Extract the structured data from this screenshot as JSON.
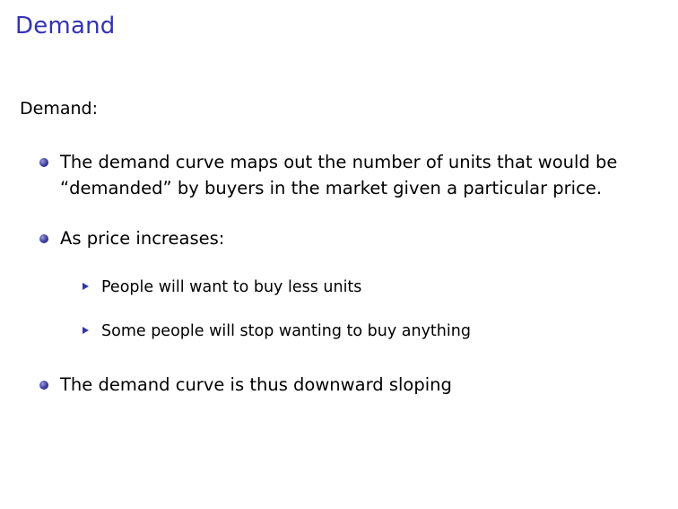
{
  "slide": {
    "title": "Demand",
    "section_label": "Demand:",
    "bullets": [
      {
        "lines": [
          "The demand curve maps out the number of units that would be",
          "“demanded” by buyers in the market given a particular price."
        ]
      },
      {
        "lines": [
          "As price increases:"
        ],
        "sub_bullets": [
          "People will want to buy less units",
          "Some people will stop wanting to buy anything"
        ]
      },
      {
        "lines": [
          "The demand curve is thus downward sloping"
        ]
      }
    ],
    "colors": {
      "title": "#3333b3",
      "bullet": "#3a3aa0",
      "sub_bullet": "#3333b3"
    },
    "icons": {
      "bullet": "ball-bullet-icon",
      "sub_bullet": "triangle-bullet-icon"
    }
  }
}
